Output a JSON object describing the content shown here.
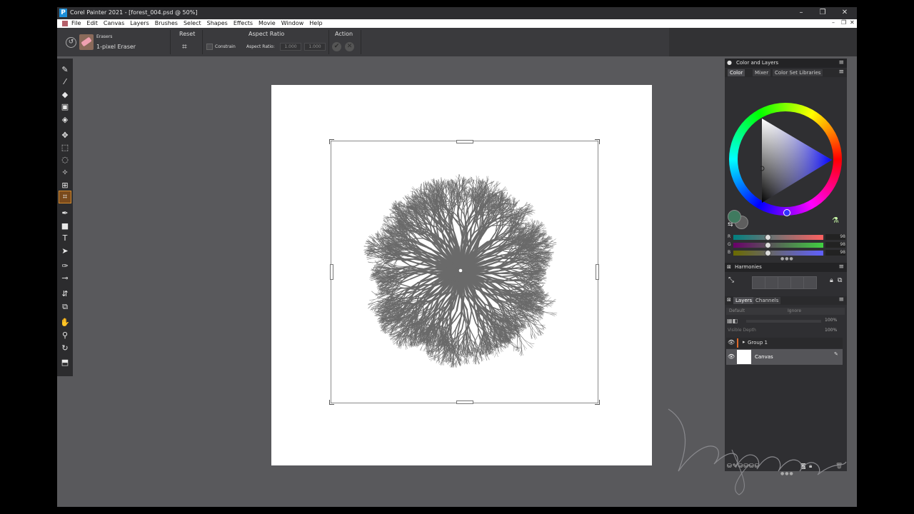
{
  "window": {
    "title": "Corel Painter 2021 - [forest_004.psd @ 50%]",
    "logo_letter": "P",
    "minimize": "–",
    "restore": "❐",
    "close": "✕"
  },
  "menu": {
    "items": [
      "File",
      "Edit",
      "Canvas",
      "Layers",
      "Brushes",
      "Select",
      "Shapes",
      "Effects",
      "Movie",
      "Window",
      "Help"
    ],
    "mdi_minimize": "–",
    "mdi_restore": "❐",
    "mdi_close": "✕"
  },
  "property_bar": {
    "brush_category": "Erasers",
    "brush_variant": "1-pixel Eraser",
    "reset_label": "Reset",
    "aspect_ratio_header": "Aspect Ratio",
    "constrain_label": "Constrain",
    "aspect_ratio_label": "Aspect Ratio:",
    "aspect_w": "1.000",
    "aspect_h": "1.000",
    "action_header": "Action",
    "commit_glyph": "✔",
    "cancel_glyph": "✕"
  },
  "toolbox": {
    "tools": [
      {
        "name": "brush-tool-icon",
        "glyph": "✎"
      },
      {
        "name": "dropper-tool-icon",
        "glyph": "⁄"
      },
      {
        "name": "paint-bucket-icon",
        "glyph": "◆"
      },
      {
        "name": "gradient-tool-icon",
        "glyph": "▣"
      },
      {
        "name": "eraser-tool-icon",
        "glyph": "◈"
      },
      {
        "name": "layer-adjuster-icon",
        "glyph": "✥"
      },
      {
        "name": "rect-selection-icon",
        "glyph": "⬚"
      },
      {
        "name": "lasso-icon",
        "glyph": "◌"
      },
      {
        "name": "magic-wand-icon",
        "glyph": "✧"
      },
      {
        "name": "transform-icon",
        "glyph": "⊞"
      },
      {
        "name": "crop-tool-icon",
        "glyph": "⌗"
      },
      {
        "name": "pen-tool-icon",
        "glyph": "✒"
      },
      {
        "name": "rectangle-shape-icon",
        "glyph": "■"
      },
      {
        "name": "text-tool-icon",
        "glyph": "T"
      },
      {
        "name": "shape-selection-icon",
        "glyph": "➤"
      },
      {
        "name": "cloner-icon",
        "glyph": "✑"
      },
      {
        "name": "rubber-stamp-icon",
        "glyph": "⊸"
      },
      {
        "name": "mirror-icon",
        "glyph": "⇵"
      },
      {
        "name": "perspective-icon",
        "glyph": "⧉"
      },
      {
        "name": "grabber-icon",
        "glyph": "✋"
      },
      {
        "name": "magnifier-icon",
        "glyph": "⚲"
      },
      {
        "name": "rotate-page-icon",
        "glyph": "↻"
      },
      {
        "name": "navigator-icon",
        "glyph": "⬒"
      }
    ]
  },
  "color_panel": {
    "title": "Color and Layers",
    "tabs": [
      "Color",
      "Mixer",
      "Color Set Libraries"
    ],
    "menu_glyph": "≡",
    "sliders": [
      {
        "label": "R",
        "value": "98",
        "position": 0.38,
        "gradient": "linear-gradient(90deg,#008080,#ff6060)"
      },
      {
        "label": "G",
        "value": "98",
        "position": 0.38,
        "gradient": "linear-gradient(90deg,#6a006a,#40d040)"
      },
      {
        "label": "B",
        "value": "98",
        "position": 0.38,
        "gradient": "linear-gradient(90deg,#6a6a00,#6060ff)"
      }
    ],
    "main_color": "#3f7a5f",
    "secondary_color": "#5e5e5e"
  },
  "harmonies": {
    "title": "Harmonies",
    "menu_glyph": "≡"
  },
  "layers": {
    "tabs": [
      "Layers",
      "Channels"
    ],
    "menu_glyph": "≡",
    "composite_method": "Default",
    "composite_depth": "Ignore",
    "opacity": "100%",
    "visible_depth_label": "Visible Depth",
    "visible_depth": "100%",
    "items": [
      {
        "name": "Group 1",
        "type": "group"
      },
      {
        "name": "Canvas",
        "type": "canvas"
      }
    ]
  }
}
